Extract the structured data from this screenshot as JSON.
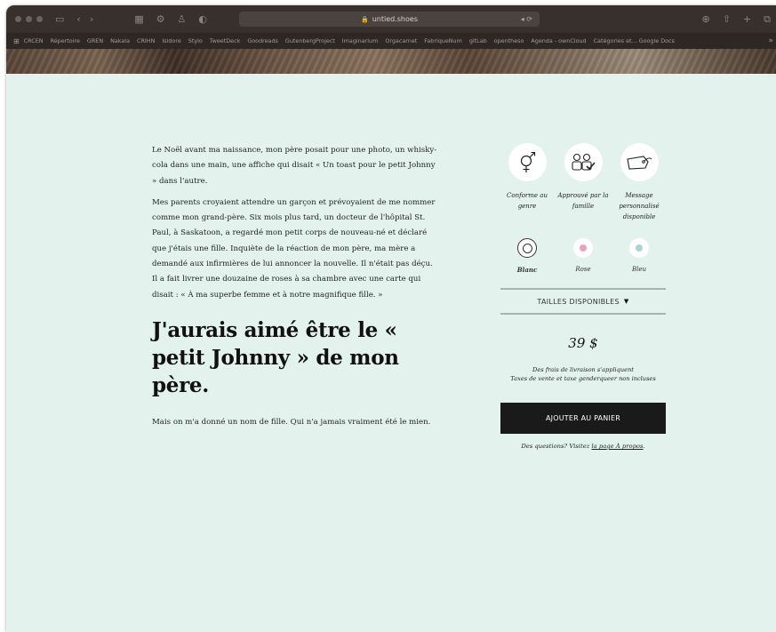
{
  "browser": {
    "url": "untied.shoes",
    "bookmarks": [
      "CRCEN",
      "Répertoire",
      "GREN",
      "Nakala",
      "CRIHN",
      "Isidore",
      "Stylo",
      "TweetDeck",
      "Goodreads",
      "GutenbergProject",
      "Imaginarium",
      "Orgacarnet",
      "FabriqueNum",
      "gitLab",
      "opentheso",
      "Agenda - ownCloud",
      "Catégories et... Google Docs"
    ]
  },
  "story": {
    "p1": "Le Noël avant ma naissance, mon père posait pour une photo, un whisky-cola dans une main, une affiche qui disait « Un toast pour le petit Johnny » dans l'autre.",
    "p2": "Mes parents croyaient attendre un garçon et prévoyaient de me nommer comme mon grand-père. Six mois plus tard, un docteur de l'hôpital St. Paul, à Saskatoon, a regardé mon petit corps de nouveau-né et déclaré que j'étais une fille. Inquiète de la réaction de mon père, ma mère a demandé aux infirmières de lui annoncer la nouvelle. Il n'était pas déçu. Il a fait livrer une douzaine de roses à sa chambre avec une carte qui disait : « À ma superbe femme et à notre magnifique fille. »",
    "headline": "J'aurais aimé être le « petit Johnny » de mon père.",
    "p3": "Mais on m'a donné un nom de fille. Qui n'a jamais vraiment été le mien."
  },
  "product": {
    "attributes": [
      {
        "icon": "gender-icon",
        "label": "Conforme au genre"
      },
      {
        "icon": "family-icon",
        "label": "Approuvé par la famille"
      },
      {
        "icon": "tag-icon",
        "label": "Message personnalisé disponible"
      }
    ],
    "colors": [
      {
        "label": "Blanc",
        "color": "#ffffff",
        "selected": true
      },
      {
        "label": "Rose",
        "color": "#e9a3bf",
        "selected": false
      },
      {
        "label": "Bleu",
        "color": "#a8d5cf",
        "selected": false
      }
    ],
    "sizes_label": "TAILLES DISPONIBLES",
    "price": "39 $",
    "fees_line1": "Des frais de livraison s'appliquent",
    "fees_line2": "Taxes de vente et taxe genderqueer non incluses",
    "cart_label": "AJOUTER AU PANIER",
    "questions_text": "Des questions? Visitez",
    "questions_link": "la page À propos",
    "questions_end": "."
  },
  "colors": {
    "background": "#e3f2ed",
    "button": "#1a1a1a"
  }
}
